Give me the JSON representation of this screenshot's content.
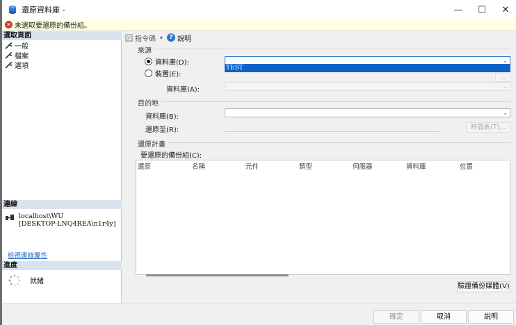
{
  "window": {
    "title": "還原資料庫 -",
    "controls": {
      "minimize": "—",
      "maximize": "☐",
      "close": "✕"
    }
  },
  "error_bar": {
    "icon": "error-icon",
    "message": "未選取要還原的備份組。"
  },
  "left_panel": {
    "select_page_header": "選取頁面",
    "pages": [
      {
        "label": "一般",
        "icon": "wrench-icon"
      },
      {
        "label": "檔案",
        "icon": "wrench-icon"
      },
      {
        "label": "選項",
        "icon": "wrench-icon"
      }
    ],
    "connection_header": "連線",
    "connection": {
      "server": "localhost\\WU",
      "user": "[DESKTOP-LNQ4REA\\n1r4y]",
      "view_properties_link": "檢視連線屬性"
    },
    "progress_header": "進度",
    "progress_status": "就緒"
  },
  "toolbar": {
    "script_label": "指令碼",
    "dropdown_arrow": "▾",
    "help_label": "說明",
    "help_icon_glyph": "?"
  },
  "source": {
    "title": "來源",
    "database_radio_label": "資料庫(D):",
    "database_radio_checked": true,
    "device_radio_label": "裝置(E):",
    "device_radio_checked": false,
    "database_dropdown_value": "",
    "database_dropdown_options": [
      "TEST"
    ],
    "device_browse_label": "...",
    "device_database_label": "資料庫(A):"
  },
  "destination": {
    "title": "目的地",
    "database_label": "資料庫(B):",
    "database_value": "",
    "restore_to_label": "還原至(R):",
    "timeline_button": "時間表(T)..."
  },
  "restore_plan": {
    "title": "還原計畫",
    "backup_sets_label": "要還原的備份組(C):",
    "columns": [
      "還原",
      "名稱",
      "元件",
      "類型",
      "伺服器",
      "資料庫",
      "位置"
    ],
    "rows": [],
    "verify_button": "驗證備份媒體(V)"
  },
  "footer": {
    "ok_button": "確定",
    "cancel_button": "取消",
    "help_button": "說明"
  },
  "colors": {
    "selection_blue": "#0b63c9",
    "error_red": "#c73b3b",
    "link_blue": "#2a6fc9",
    "section_header_bg": "#d9e3ee",
    "error_bar_bg": "#ffffe1"
  }
}
